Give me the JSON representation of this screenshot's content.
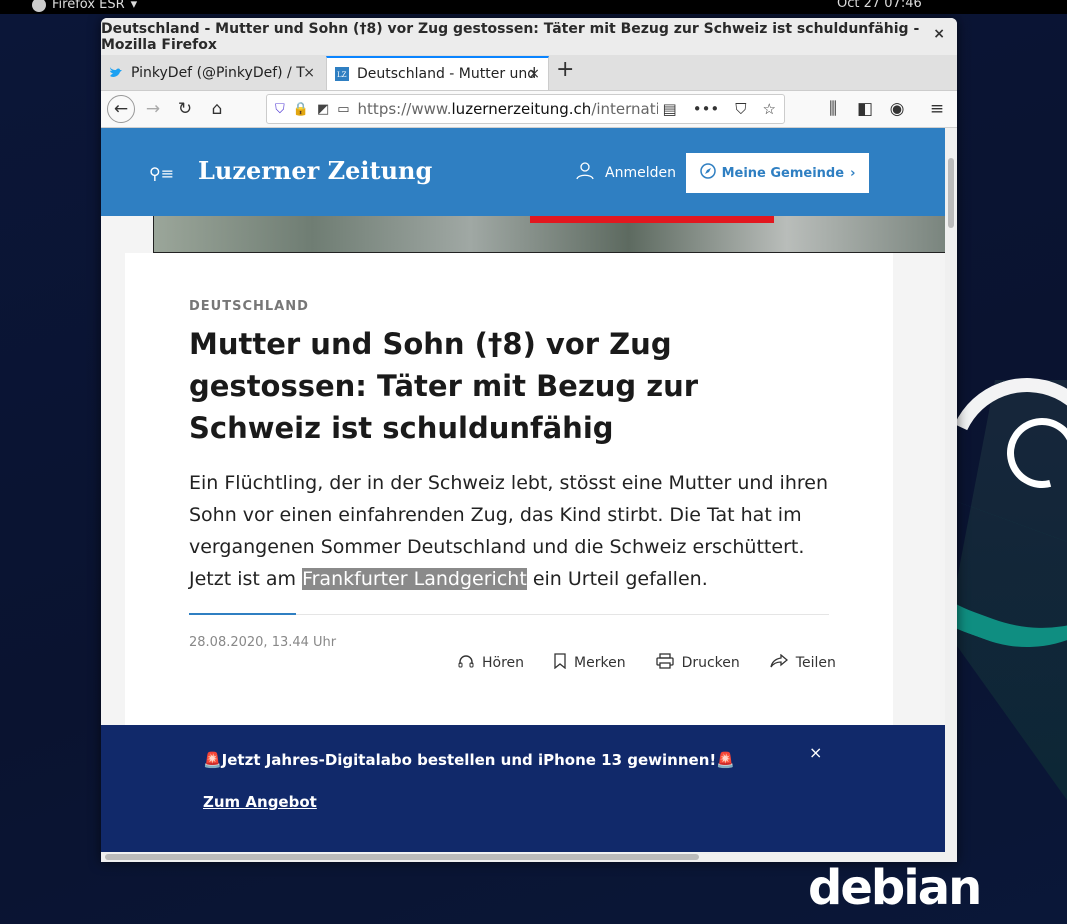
{
  "desktop": {
    "app_name": "Firefox ESR",
    "clock": "Oct 27  07:46",
    "os_logo": "debian"
  },
  "window": {
    "title": "Deutschland - Mutter und Sohn (†8) vor Zug gestossen: Täter mit Bezug zur Schweiz ist schuldunfähig - Mozilla Firefox",
    "close": "×"
  },
  "tabs": [
    {
      "label": "PinkyDef (@PinkyDef) / T",
      "close": "×"
    },
    {
      "label": "Deutschland - Mutter und",
      "close": "×"
    }
  ],
  "new_tab": "+",
  "navbar": {
    "url_prefix": "https://www.",
    "url_host": "luzernerzeitung.ch",
    "url_path": "/internatio",
    "overflow": "•••"
  },
  "site": {
    "logo": "Luzerner Zeitung",
    "login": "Anmelden",
    "gemeinde": "Meine Gemeinde",
    "gemeinde_chevron": "›"
  },
  "article": {
    "kicker": "DEUTSCHLAND",
    "headline": "Mutter und Sohn (†8) vor Zug gestossen: Täter mit Bezug zur Schweiz ist schuldunfähig",
    "lead_before": "Ein Flüchtling, der in der Schweiz lebt, stösst eine Mutter und ihren Sohn vor einen einfahrenden Zug, das Kind stirbt. Die Tat hat im vergangenen Sommer Deutschland und die Schweiz erschüttert. Jetzt ist am ",
    "lead_highlight": "Frankfurter Landgericht",
    "lead_after": " ein Urteil gefallen.",
    "date": "28.08.2020, 13.44 Uhr",
    "actions": {
      "listen": "Hören",
      "bookmark": "Merken",
      "print": "Drucken",
      "share": "Teilen"
    }
  },
  "promo": {
    "text": "🚨Jetzt Jahres-Digitalabo bestellen und iPhone 13 gewinnen!🚨",
    "link": "Zum Angebot",
    "close": "×"
  },
  "colors": {
    "header_blue": "#2f7fc2",
    "promo_navy": "#11296a",
    "tab_accent": "#0a84ff"
  }
}
